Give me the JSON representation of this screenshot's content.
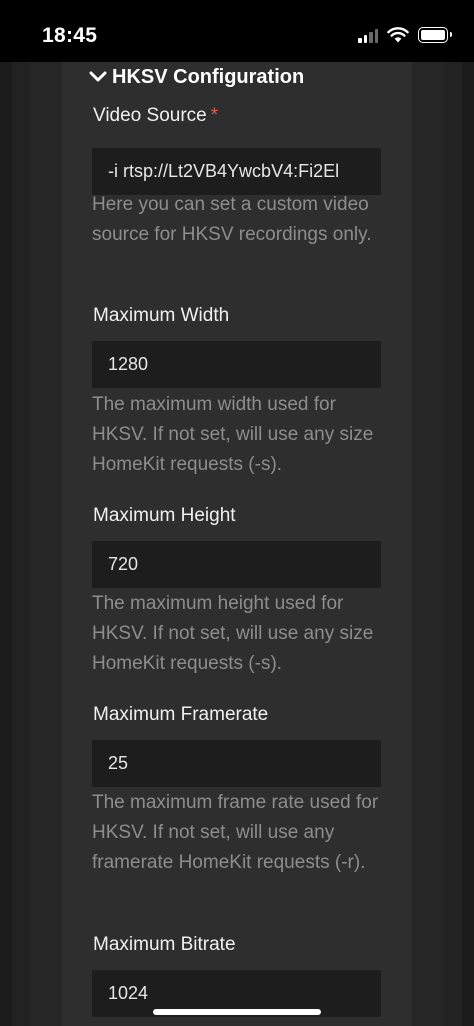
{
  "status_bar": {
    "time": "18:45"
  },
  "section": {
    "title": "HKSV Configuration",
    "expanded": true
  },
  "fields": [
    {
      "label": "Video Source",
      "required_marker": "*",
      "value": "-i rtsp://Lt2VB4YwcbV4:Fi2El",
      "help": "Here you can set a custom video source for HKSV recordings only."
    },
    {
      "label": "Maximum Width",
      "value": "1280",
      "help": "The maximum width used for HKSV. If not set, will use any size HomeKit requests (-s)."
    },
    {
      "label": "Maximum Height",
      "value": "720",
      "help": "The maximum height used for HKSV. If not set, will use any size HomeKit requests (-s)."
    },
    {
      "label": "Maximum Framerate",
      "value": "25",
      "help": "The maximum frame rate used for HKSV. If not set, will use any framerate HomeKit requests (-r)."
    },
    {
      "label": "Maximum Bitrate",
      "value": "1024"
    }
  ],
  "colors": {
    "background": "#1b1b1b",
    "input_background": "#1d1d1d",
    "help_text": "#8d8d8d",
    "required": "#e25b5b"
  }
}
